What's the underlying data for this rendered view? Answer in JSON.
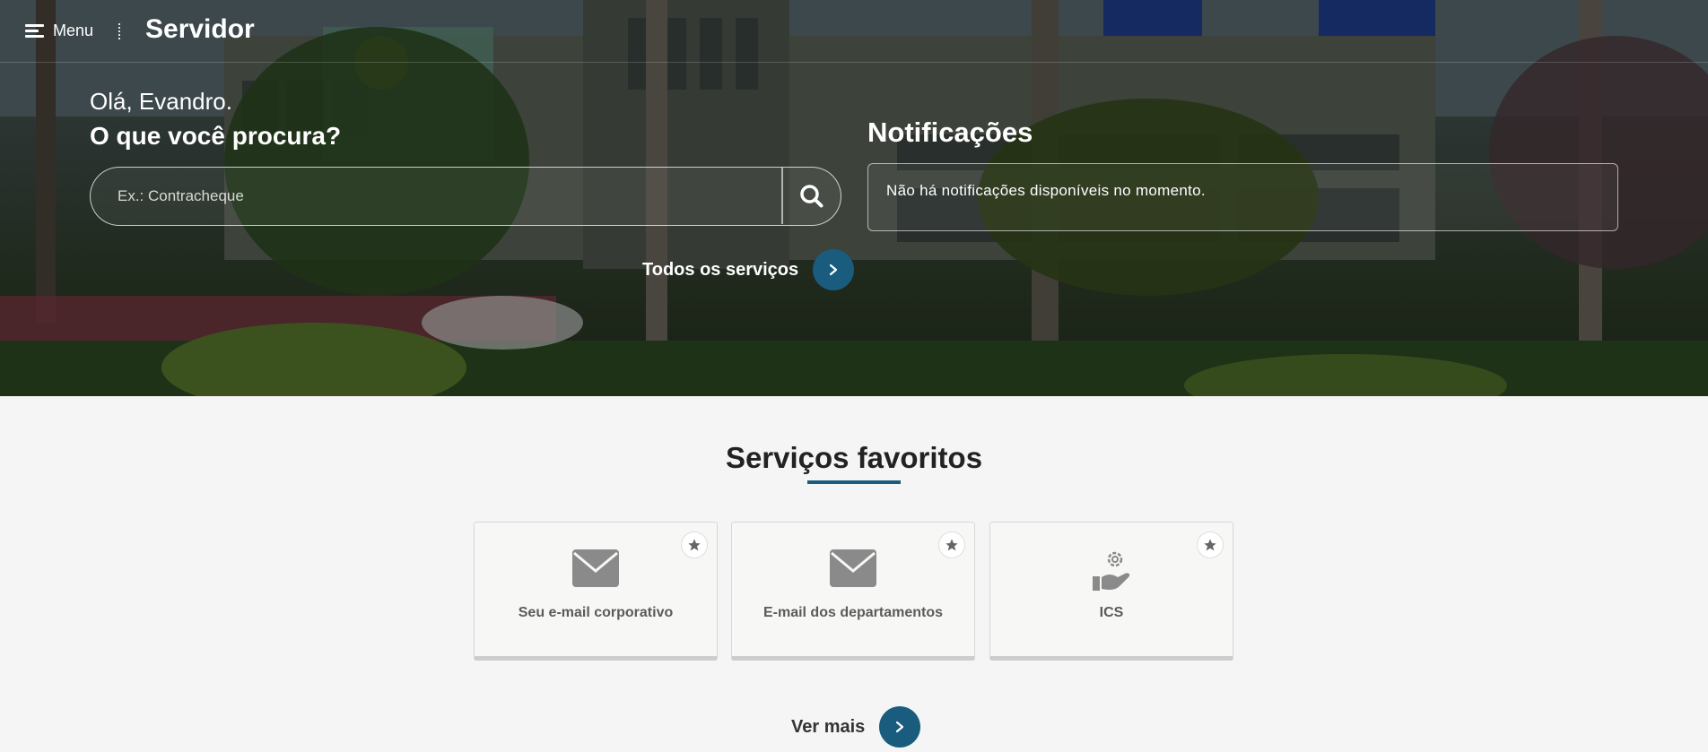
{
  "header": {
    "menu_label": "Menu",
    "brand": "Servidor"
  },
  "hero": {
    "greeting": "Olá, Evandro.",
    "question": "O que você procura?",
    "search_placeholder": "Ex.: Contracheque",
    "search_value": "",
    "all_services_label": "Todos os serviços"
  },
  "notifications": {
    "title": "Notificações",
    "message": "Não há notificações disponíveis no momento."
  },
  "favorites": {
    "title": "Serviços favoritos",
    "cards": [
      {
        "label": "Seu e-mail corporativo",
        "icon": "envelope-icon"
      },
      {
        "label": "E-mail dos departamentos",
        "icon": "envelope-icon"
      },
      {
        "label": "ICS",
        "icon": "hand-gear-icon"
      }
    ],
    "more_label": "Ver mais"
  },
  "colors": {
    "accent": "#1a5c7e",
    "background": "#f4f5f4",
    "icon_gray": "#8a8a8a"
  }
}
